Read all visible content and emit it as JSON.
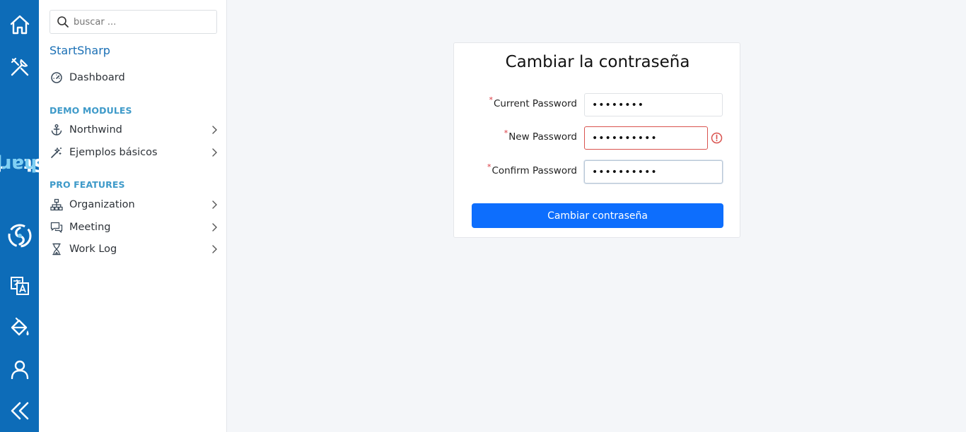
{
  "rail": {
    "brand_part1": "Start",
    "brand_part2": "Sharp",
    "accent_color": "#0d6cb8",
    "icons": [
      "home-icon",
      "tools-icon",
      "translate-icon",
      "paint-bucket-icon",
      "user-icon",
      "collapse-icon"
    ]
  },
  "sidebar": {
    "search_placeholder": "buscar ...",
    "title": "StartSharp",
    "dashboard": "Dashboard",
    "section1": "DEMO MODULES",
    "northwind": "Northwind",
    "basic_examples": "Ejemplos básicos",
    "section2": "PRO FEATURES",
    "organization": "Organization",
    "meeting": "Meeting",
    "work_log": "Work Log"
  },
  "form": {
    "title": "Cambiar la contraseña",
    "current_label": "Current Password",
    "current_value": "••••••••",
    "new_label": "New Password",
    "new_value": "••••••••••",
    "confirm_label": "Confirm Password",
    "confirm_value": "••••••••••",
    "required_mark": "*",
    "submit_label": "Cambiar contraseña",
    "submit_color": "#0d6efd",
    "error_color": "#d9534f"
  }
}
